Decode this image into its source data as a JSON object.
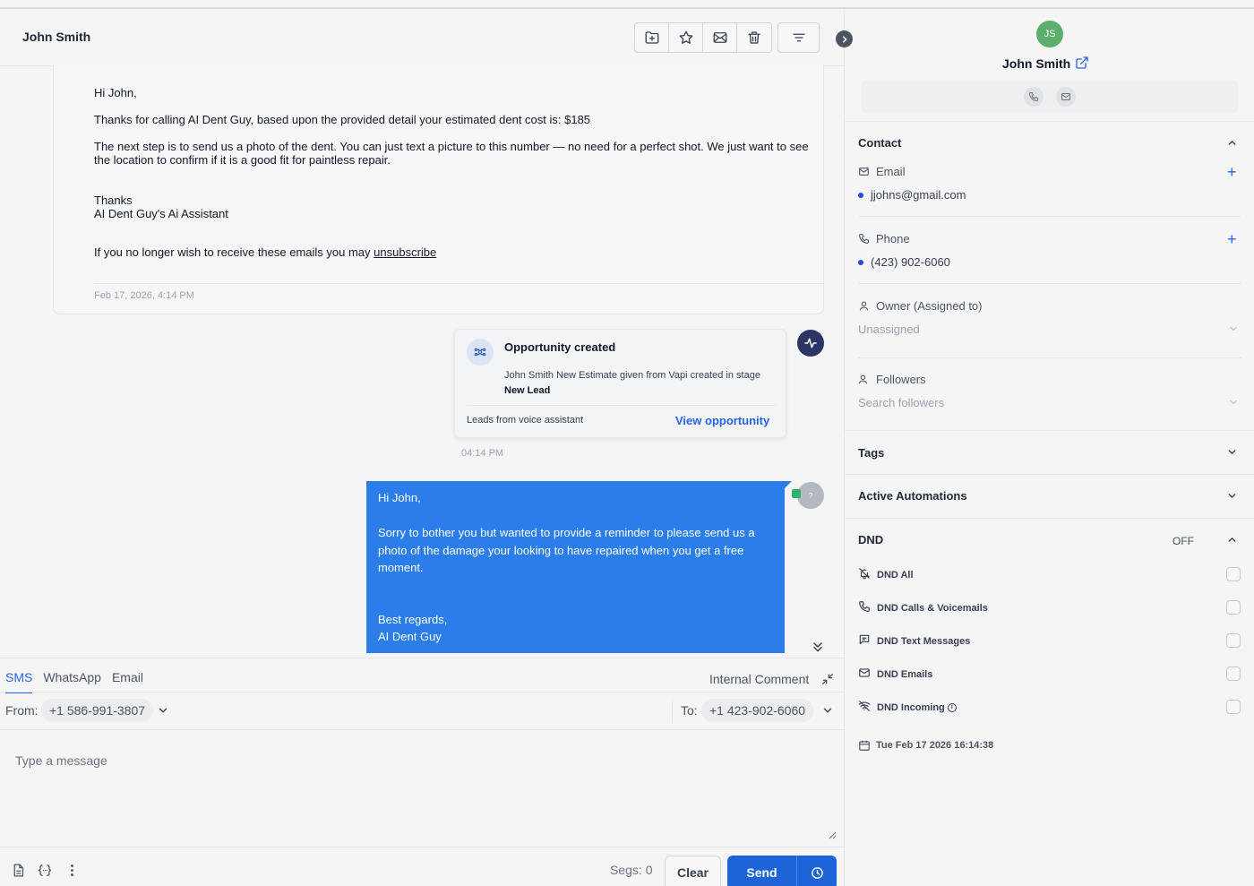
{
  "conversation": {
    "contact_name": "John Smith",
    "toolbar": {
      "move_icon": "folder-plus-icon",
      "star_icon": "star-icon",
      "mail_icon": "mail-icon",
      "delete_icon": "trash-icon",
      "filter_icon": "filter-icon"
    },
    "email": {
      "greeting": "Hi John,",
      "line1": "Thanks for calling AI Dent Guy, based upon the provided detail your estimated dent cost is: $185",
      "line2": "The next step is to send us a photo of the dent. You can just text a picture to this number — no need for a perfect shot. We just want to see the location to confirm if it is a good fit for paintless repair.",
      "thanks": "Thanks",
      "signature": "AI Dent Guy's Ai Assistant",
      "unsubscribe_prefix": "If you no longer wish to receive these emails you may ",
      "unsubscribe_link": "unsubscribe",
      "timestamp": "Feb 17, 2026, 4:14 PM"
    },
    "opportunity": {
      "title": "Opportunity created",
      "desc_prefix": "John Smith New Estimate given from Vapi created in stage ",
      "stage": "New Lead",
      "source": "Leads from voice assistant",
      "link": "View opportunity",
      "time": "04:14 PM"
    },
    "sms": {
      "greeting": "Hi John,",
      "body": "Sorry to bother you but wanted to provide a reminder to please send us a photo of the damage your looking to have repaired when you get a free moment.",
      "closing": "Best regards,",
      "signature": "AI Dent Guy",
      "avatar_text": "?"
    }
  },
  "composer": {
    "tabs": [
      "SMS",
      "WhatsApp",
      "Email"
    ],
    "active_tab": "SMS",
    "internal_comment": "Internal Comment",
    "from_label": "From:",
    "from_number": "+1 586-991-3807",
    "to_label": "To:",
    "to_number": "+1 423-902-6060",
    "placeholder": "Type a message",
    "segs": "Segs: 0",
    "clear": "Clear",
    "send": "Send"
  },
  "contact_panel": {
    "initials": "JS",
    "name": "John Smith",
    "contact_section": "Contact",
    "email_label": "Email",
    "email_value": "jjohns@gmail.com",
    "phone_label": "Phone",
    "phone_value": "(423) 902-6060",
    "owner_label": "Owner (Assigned to)",
    "owner_value": "Unassigned",
    "followers_label": "Followers",
    "followers_placeholder": "Search followers",
    "tags": "Tags",
    "automations": "Active Automations",
    "dnd": "DND",
    "dnd_status": "OFF",
    "dnd_items": [
      {
        "label": "DND All",
        "icon": "bell-off-icon",
        "checked": false
      },
      {
        "label": "DND Calls & Voicemails",
        "icon": "phone-icon",
        "checked": false
      },
      {
        "label": "DND Text Messages",
        "icon": "message-icon",
        "checked": false
      },
      {
        "label": "DND Emails",
        "icon": "mail-icon",
        "checked": false
      },
      {
        "label": "DND Incoming",
        "icon": "wifi-off-icon",
        "checked": false
      }
    ],
    "created_date": "Tue Feb 17 2026 16:14:38"
  },
  "colors": {
    "accent": "#2563eb",
    "sms_bubble": "#2b7ee9",
    "avatar": "#5cae6d",
    "activity_badge": "#2d3565"
  }
}
